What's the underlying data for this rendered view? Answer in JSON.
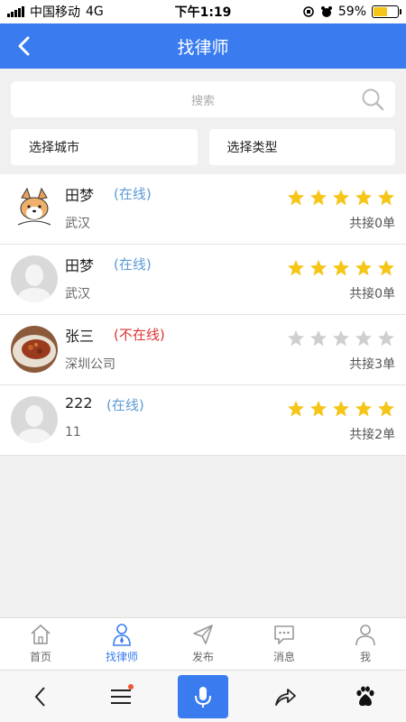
{
  "status_bar": {
    "carrier": "中国移动",
    "network": "4G",
    "time": "下午1:19",
    "battery": "59%",
    "battery_level": 0.59
  },
  "header": {
    "title": "找律师",
    "back_icon": "back-arrow-icon"
  },
  "search": {
    "placeholder": "搜索"
  },
  "filters": {
    "city": "选择城市",
    "type": "选择类型"
  },
  "lawyers": [
    {
      "name": "田梦",
      "status": "(在线)",
      "online": true,
      "city": "武汉",
      "rating": 5,
      "orders": "共接0单",
      "avatar": "corgi-avatar"
    },
    {
      "name": "田梦",
      "status": "(在线)",
      "online": true,
      "city": "武汉",
      "rating": 5,
      "orders": "共接0单",
      "avatar": "default-avatar"
    },
    {
      "name": "张三",
      "status": "(不在线)",
      "online": false,
      "city": "深圳公司",
      "rating": 0,
      "orders": "共接3单",
      "avatar": "food-photo-avatar"
    },
    {
      "name": "222",
      "status": "(在线)",
      "online": true,
      "city": "11",
      "rating": 5,
      "orders": "共接2单",
      "avatar": "default-avatar"
    }
  ],
  "tabs": [
    {
      "label": "首页",
      "icon": "home-icon",
      "active": false
    },
    {
      "label": "找律师",
      "icon": "lawyer-icon",
      "active": true
    },
    {
      "label": "发布",
      "icon": "send-icon",
      "active": false
    },
    {
      "label": "消息",
      "icon": "message-icon",
      "active": false
    },
    {
      "label": "我",
      "icon": "user-icon",
      "active": false
    }
  ],
  "browser_toolbar": [
    "back-icon",
    "menu-icon",
    "mic-icon",
    "share-icon",
    "baidu-paw-icon"
  ],
  "colors": {
    "accent": "#3a7cf0",
    "star_filled": "#f5c518",
    "star_empty": "#cfcfcf",
    "online": "#5b9bd5",
    "offline": "#d33333"
  }
}
